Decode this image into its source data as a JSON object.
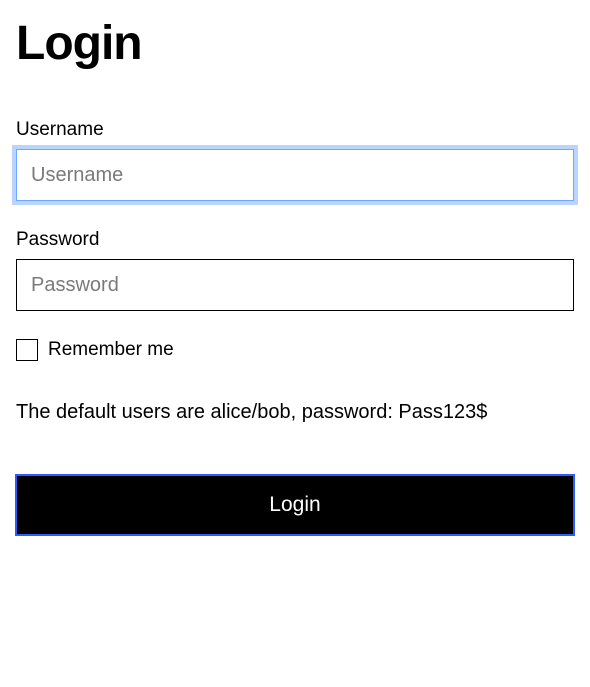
{
  "title": "Login",
  "fields": {
    "username": {
      "label": "Username",
      "placeholder": "Username",
      "value": ""
    },
    "password": {
      "label": "Password",
      "placeholder": "Password",
      "value": ""
    }
  },
  "remember": {
    "label": "Remember me",
    "checked": false
  },
  "hint": "The default users are alice/bob, password: Pass123$",
  "submit_label": "Login"
}
